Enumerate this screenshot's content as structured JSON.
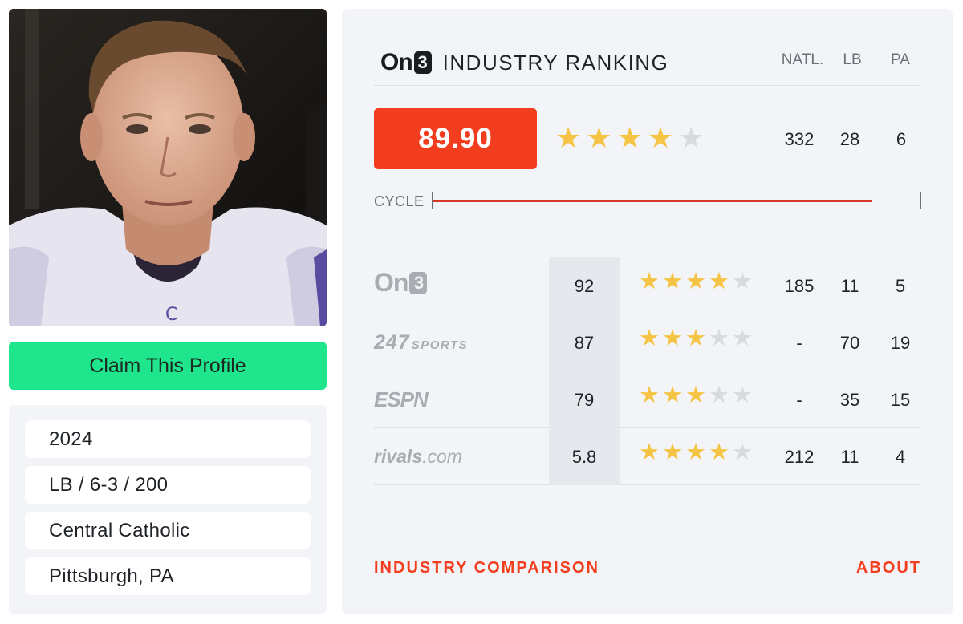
{
  "colors": {
    "accent_red": "#f23d1e",
    "claim_green": "#1fe58c",
    "star_gold": "#f5c445",
    "star_empty": "#d8dadd",
    "cycle_line": "#d7382a"
  },
  "profile": {
    "photo_icon": "player-headshot-image",
    "claim_label": "Claim This Profile",
    "details": [
      "2024",
      "LB / 6-3 / 200",
      "Central Catholic",
      "Pittsburgh, PA"
    ]
  },
  "industry": {
    "logo": {
      "on": "On",
      "three": "3"
    },
    "title": "INDUSTRY RANKING",
    "columns": [
      "NATL.",
      "LB",
      "PA"
    ],
    "score": "89.90",
    "stars": 4,
    "ranks": [
      "332",
      "28",
      "6"
    ],
    "cycle": {
      "label": "CYCLE",
      "progress": 0.9,
      "tick_count": 6
    }
  },
  "services": [
    {
      "logo_icon": "on3-logo",
      "logo": {
        "on": "On",
        "three": "3"
      },
      "score": "92",
      "stars": 4,
      "ranks": [
        "185",
        "11",
        "5"
      ]
    },
    {
      "logo_icon": "247sports-logo",
      "logo": {
        "main": "247",
        "sub": "SPORTS"
      },
      "score": "87",
      "stars": 3,
      "ranks": [
        "-",
        "70",
        "19"
      ]
    },
    {
      "logo_icon": "espn-logo",
      "logo": {
        "main": "ESPN"
      },
      "score": "79",
      "stars": 3,
      "ranks": [
        "-",
        "35",
        "15"
      ]
    },
    {
      "logo_icon": "rivals-logo",
      "logo": {
        "main": "rivals",
        "sub": ".com"
      },
      "score": "5.8",
      "stars": 4,
      "ranks": [
        "212",
        "11",
        "4"
      ]
    }
  ],
  "footer": {
    "comparison_label": "INDUSTRY COMPARISON",
    "about_label": "ABOUT"
  }
}
